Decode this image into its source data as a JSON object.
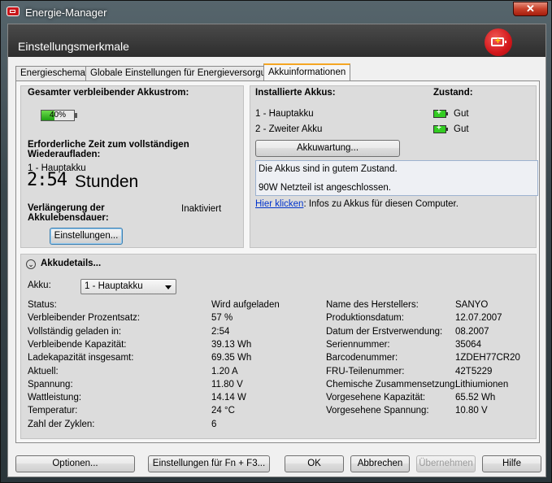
{
  "window": {
    "title": "Energie-Manager",
    "close_glyph": "✕"
  },
  "header": {
    "title": "Einstellungsmerkmale"
  },
  "tabs": [
    {
      "label": "Energieschema"
    },
    {
      "label": "Globale Einstellungen für Energieversorgung"
    },
    {
      "label": "Akkuinformationen"
    }
  ],
  "remaining": {
    "heading": "Gesamter verbleibender Akkustrom:",
    "percent_label": "40%",
    "percent_value": 40
  },
  "recharge": {
    "heading_line1": "Erforderliche Zeit zum vollständigen",
    "heading_line2": "Wiederaufladen:",
    "battery": "1 - Hauptakku",
    "time": "2:54",
    "unit": "Stunden"
  },
  "lifetime": {
    "label_line1": "Verlängerung der",
    "label_line2": "Akkulebensdauer:",
    "status": "Inaktiviert",
    "button": "Einstellungen..."
  },
  "installed": {
    "heading": "Installierte Akkus:",
    "state_heading": "Zustand:",
    "rows": [
      {
        "name": "1 - Hauptakku",
        "state": "Gut",
        "icon": "battery-good-icon"
      },
      {
        "name": "2 - Zweiter Akku",
        "state": "Gut",
        "icon": "battery-good-icon"
      }
    ],
    "maintenance_button": "Akkuwartung...",
    "message_line1": "Die Akkus sind in gutem Zustand.",
    "message_line2": "90W Netzteil ist angeschlossen.",
    "link_text": "Hier klicken",
    "link_suffix": ": Infos zu Akkus für diesen Computer."
  },
  "details": {
    "heading": "Akkudetails...",
    "akku_label": "Akku:",
    "akku_selected": "1 - Hauptakku",
    "left": [
      {
        "label": "Status:",
        "value": "Wird aufgeladen"
      },
      {
        "label": "Verbleibender Prozentsatz:",
        "value": "57 %"
      },
      {
        "label": "Vollständig geladen in:",
        "value": "2:54"
      },
      {
        "label": "Verbleibende Kapazität:",
        "value": "39.13 Wh"
      },
      {
        "label": "Ladekapazität insgesamt:",
        "value": "69.35 Wh"
      },
      {
        "label": "Aktuell:",
        "value": "1.20 A"
      },
      {
        "label": "Spannung:",
        "value": "11.80 V"
      },
      {
        "label": "Wattleistung:",
        "value": "14.14 W"
      },
      {
        "label": "Temperatur:",
        "value": "24 °C"
      },
      {
        "label": "Zahl der Zyklen:",
        "value": "6"
      }
    ],
    "right": [
      {
        "label": "Name des Herstellers:",
        "value": "SANYO"
      },
      {
        "label": "Produktionsdatum:",
        "value": "12.07.2007"
      },
      {
        "label": "Datum der Erstverwendung:",
        "value": "08.2007"
      },
      {
        "label": "Seriennummer:",
        "value": "35064"
      },
      {
        "label": "Barcodenummer:",
        "value": "1ZDEH77CR20"
      },
      {
        "label": "FRU-Teilenummer:",
        "value": "42T5229"
      },
      {
        "label": "Chemische Zusammensetzung:",
        "value": "Lithiumionen"
      },
      {
        "label": "Vorgesehene Kapazität:",
        "value": "65.52 Wh"
      },
      {
        "label": "Vorgesehene Spannung:",
        "value": "10.80 V"
      }
    ]
  },
  "footer": {
    "options": "Optionen...",
    "fn_settings": "Einstellungen für Fn + F3...",
    "ok": "OK",
    "cancel": "Abbrechen",
    "apply": "Übernehmen",
    "help": "Hilfe"
  }
}
